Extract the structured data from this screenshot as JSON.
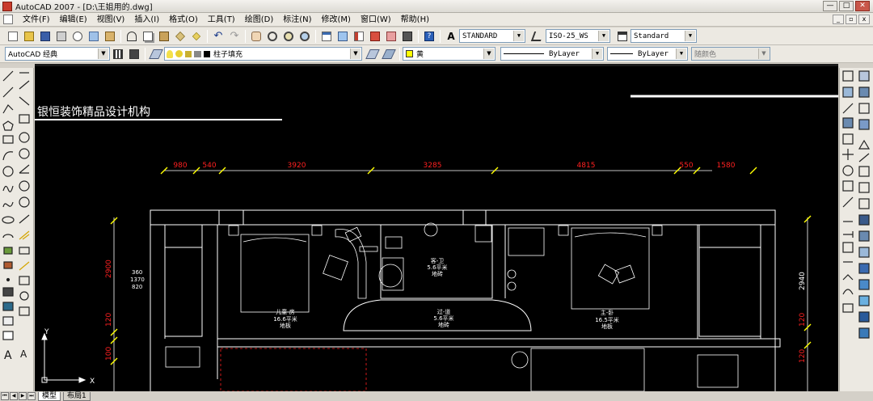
{
  "window": {
    "title": "AutoCAD 2007 - [D:\\王姐用的.dwg]",
    "minimize": "—",
    "maximize": "□",
    "close": "✕"
  },
  "menu": [
    "文件(F)",
    "编辑(E)",
    "视图(V)",
    "插入(I)",
    "格式(O)",
    "工具(T)",
    "绘图(D)",
    "标注(N)",
    "修改(M)",
    "窗口(W)",
    "帮助(H)"
  ],
  "toolbar": {
    "text_style": "STANDARD",
    "dim_style": "ISO-25_WS",
    "table_style": "Standard",
    "workspace": "AutoCAD 经典",
    "layer": "柱子填充",
    "color": "黄",
    "linetype": "ByLayer",
    "lineweight": "ByLayer",
    "plot_style": "随颜色"
  },
  "drawing": {
    "company": "银恒装饰精品设计机构",
    "dimensions": [
      "980",
      "540",
      "3920",
      "3285",
      "4815",
      "550",
      "1580"
    ],
    "left_dims": [
      "2900",
      "120",
      "100"
    ],
    "left_stack": [
      "360",
      "1370",
      "820"
    ],
    "right_dims": [
      "2940",
      "120",
      "120"
    ],
    "rooms": [
      {
        "name": "儿童-房",
        "area": "16.6平米",
        "floor": "地板"
      },
      {
        "name": "客-卫",
        "area": "5.6平米",
        "floor": "地砖"
      },
      {
        "name": "过-道",
        "area": "5.6平米",
        "floor": "地砖"
      },
      {
        "name": "主-卧",
        "area": "16.5平米",
        "floor": "地板"
      }
    ],
    "axis_x": "X",
    "axis_y": "Y"
  },
  "layout_tabs": [
    "模型",
    "布局1"
  ],
  "colors": {
    "canvas": "#000000",
    "dimension": "#ff2020",
    "tick": "#ffff00",
    "linework": "#ffffff"
  }
}
